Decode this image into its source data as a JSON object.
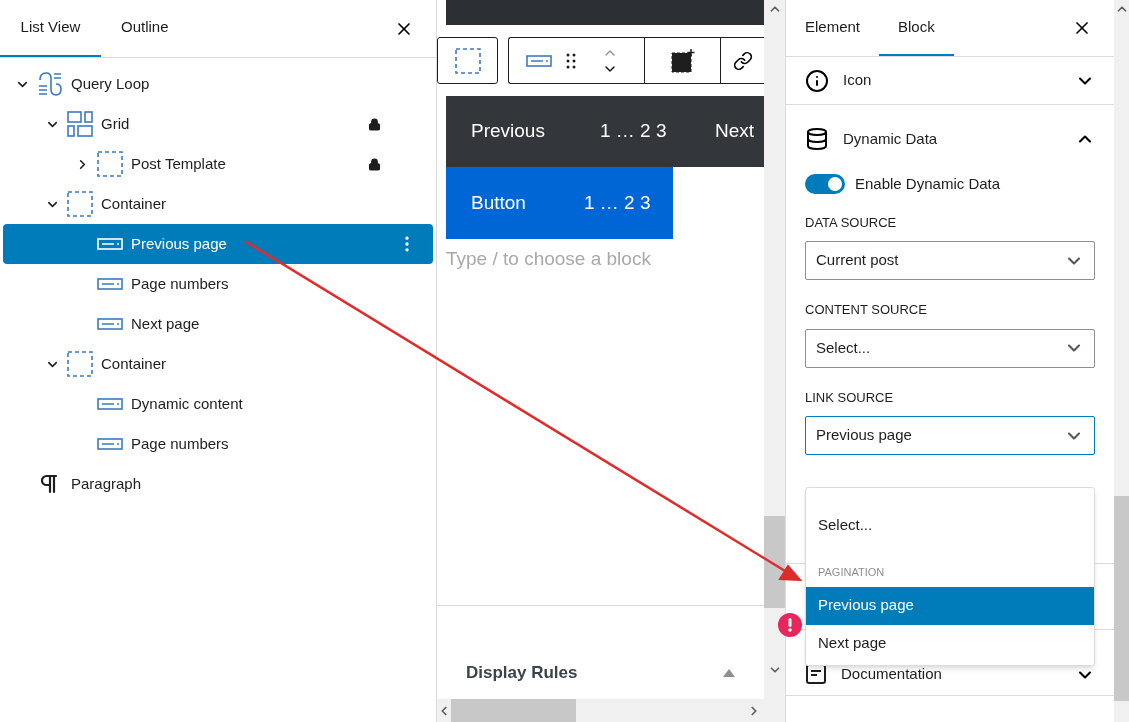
{
  "left_panel": {
    "tabs": [
      {
        "label": "List View",
        "selected": true
      },
      {
        "label": "Outline",
        "selected": false
      }
    ],
    "tree": [
      {
        "label": "Query Loop",
        "kind": "query",
        "expanded": true,
        "locked": false,
        "selected": false,
        "children": [
          {
            "label": "Grid",
            "kind": "grid",
            "expanded": true,
            "locked": true,
            "selected": false,
            "children": [
              {
                "label": "Post Template",
                "kind": "container",
                "expanded": false,
                "locked": true,
                "selected": false
              }
            ]
          },
          {
            "label": "Container",
            "kind": "container",
            "expanded": true,
            "locked": false,
            "selected": false,
            "children": [
              {
                "label": "Previous page",
                "kind": "button",
                "locked": false,
                "selected": true
              },
              {
                "label": "Page numbers",
                "kind": "button",
                "locked": false,
                "selected": false
              },
              {
                "label": "Next page",
                "kind": "button",
                "locked": false,
                "selected": false
              }
            ]
          },
          {
            "label": "Container",
            "kind": "container",
            "expanded": true,
            "locked": false,
            "selected": false,
            "children": [
              {
                "label": "Dynamic content",
                "kind": "button",
                "locked": false,
                "selected": false
              },
              {
                "label": "Page numbers",
                "kind": "button",
                "locked": false,
                "selected": false
              }
            ]
          }
        ]
      },
      {
        "label": "Paragraph",
        "kind": "paragraph",
        "locked": false,
        "selected": false
      }
    ]
  },
  "canvas": {
    "pagination_bar": [
      "Previous",
      "1 … 2 3",
      "Next"
    ],
    "button_bar": [
      "Button",
      "1 … 2 3"
    ],
    "placeholder": "Type / to choose a block",
    "display_rules": {
      "title": "Display Rules",
      "expanded": false
    }
  },
  "right_panel": {
    "tabs": [
      {
        "label": "Element",
        "selected": false
      },
      {
        "label": "Block",
        "selected": true
      }
    ],
    "sections": [
      {
        "title": "Icon",
        "kind": "info",
        "expanded": false
      },
      {
        "title": "Dynamic Data",
        "kind": "database",
        "expanded": true
      }
    ],
    "toggle": {
      "label": "Enable Dynamic Data",
      "on": true
    },
    "fields": [
      {
        "label": "DATA SOURCE",
        "value": "Current post",
        "focused": false
      },
      {
        "label": "CONTENT SOURCE",
        "value": "Select...",
        "focused": false
      },
      {
        "label": "LINK SOURCE",
        "value": "Previous page",
        "focused": true
      }
    ],
    "dropdown": [
      {
        "kind": "option",
        "label": "Select...",
        "selected": false
      },
      {
        "kind": "group",
        "label": "PAGINATION"
      },
      {
        "kind": "option",
        "label": "Previous page",
        "selected": true
      },
      {
        "kind": "option",
        "label": "Next page",
        "selected": false
      }
    ],
    "documentation": "Documentation"
  }
}
